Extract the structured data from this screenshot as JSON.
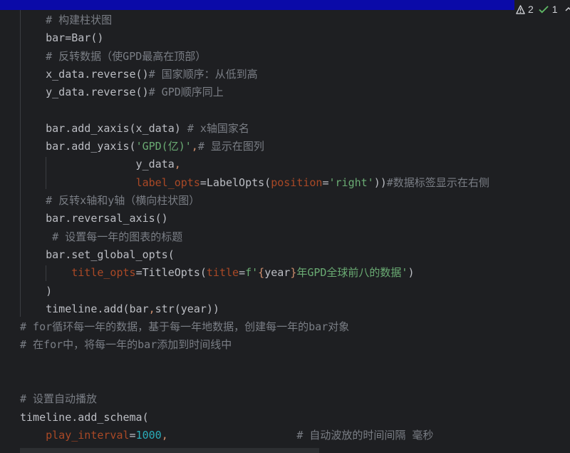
{
  "status": {
    "warnings_count": "2",
    "ok_count": "1"
  },
  "code_lines": [
    [
      {
        "t": "    "
      },
      {
        "t": "# 构建柱状图",
        "c": "c-cmt"
      }
    ],
    [
      {
        "t": "    bar=Bar()"
      }
    ],
    [
      {
        "t": "    "
      },
      {
        "t": "# 反转数据（使GPD最高在顶部）",
        "c": "c-cmt"
      }
    ],
    [
      {
        "t": "    x_data.reverse()"
      },
      {
        "t": "# 国家顺序：从低到高",
        "c": "c-cmt"
      }
    ],
    [
      {
        "t": "    y_data.reverse()"
      },
      {
        "t": "# GPD顺序同上",
        "c": "c-cmt"
      }
    ],
    [
      {
        "t": ""
      }
    ],
    [
      {
        "t": "    bar.add_xaxis(x_data) "
      },
      {
        "t": "# x轴国家名",
        "c": "c-cmt"
      }
    ],
    [
      {
        "t": "    bar.add_yaxis("
      },
      {
        "t": "'GPD(亿)'",
        "c": "c-str"
      },
      {
        "t": ",",
        "c": "c-kw"
      },
      {
        "t": "# 显示在图列",
        "c": "c-cmt"
      }
    ],
    [
      {
        "t": "                  y_data"
      },
      {
        "t": ",",
        "c": "c-kw"
      }
    ],
    [
      {
        "t": "                  "
      },
      {
        "t": "label_opts",
        "c": "c-par"
      },
      {
        "t": "=LabelOpts("
      },
      {
        "t": "position",
        "c": "c-par"
      },
      {
        "t": "="
      },
      {
        "t": "'right'",
        "c": "c-str"
      },
      {
        "t": "))"
      },
      {
        "t": "#数据标签显示在右侧",
        "c": "c-cmt"
      }
    ],
    [
      {
        "t": "    "
      },
      {
        "t": "# 反转x轴和y轴（横向柱状图）",
        "c": "c-cmt"
      }
    ],
    [
      {
        "t": "    bar.reversal_axis()"
      }
    ],
    [
      {
        "t": "     "
      },
      {
        "t": "# 设置每一年的图表的标题",
        "c": "c-cmt"
      }
    ],
    [
      {
        "t": "    bar.set_global_opts("
      }
    ],
    [
      {
        "t": "        "
      },
      {
        "t": "title_opts",
        "c": "c-par"
      },
      {
        "t": "=TitleOpts("
      },
      {
        "t": "title",
        "c": "c-par"
      },
      {
        "t": "="
      },
      {
        "t": "f'",
        "c": "c-str"
      },
      {
        "t": "{",
        "c": "c-fmt"
      },
      {
        "t": "year"
      },
      {
        "t": "}",
        "c": "c-fmt"
      },
      {
        "t": "年GPD全球前八的数据'",
        "c": "c-str"
      },
      {
        "t": ")"
      }
    ],
    [
      {
        "t": "    )"
      }
    ],
    [
      {
        "t": "    timeline.add(bar"
      },
      {
        "t": ",",
        "c": "c-kw"
      },
      {
        "t": "str(year))"
      }
    ],
    [
      {
        "t": "# for循环每一年的数据，基于每一年地数据，创建每一年的bar对象",
        "c": "c-cmt"
      }
    ],
    [
      {
        "t": "# 在for中，将每一年的bar添加到时间线中",
        "c": "c-cmt"
      }
    ],
    [
      {
        "t": ""
      }
    ],
    [
      {
        "t": ""
      }
    ],
    [
      {
        "t": "# 设置自动播放",
        "c": "c-cmt"
      }
    ],
    [
      {
        "t": "timeline.add_schema("
      }
    ],
    [
      {
        "t": "    "
      },
      {
        "t": "play_interval",
        "c": "c-par"
      },
      {
        "t": "="
      },
      {
        "t": "1000",
        "c": "c-num"
      },
      {
        "t": ",",
        "c": "c-kw"
      },
      {
        "t": "                    "
      },
      {
        "t": "# 自动波放的时间间隔 毫秒",
        "c": "c-cmt"
      }
    ]
  ]
}
